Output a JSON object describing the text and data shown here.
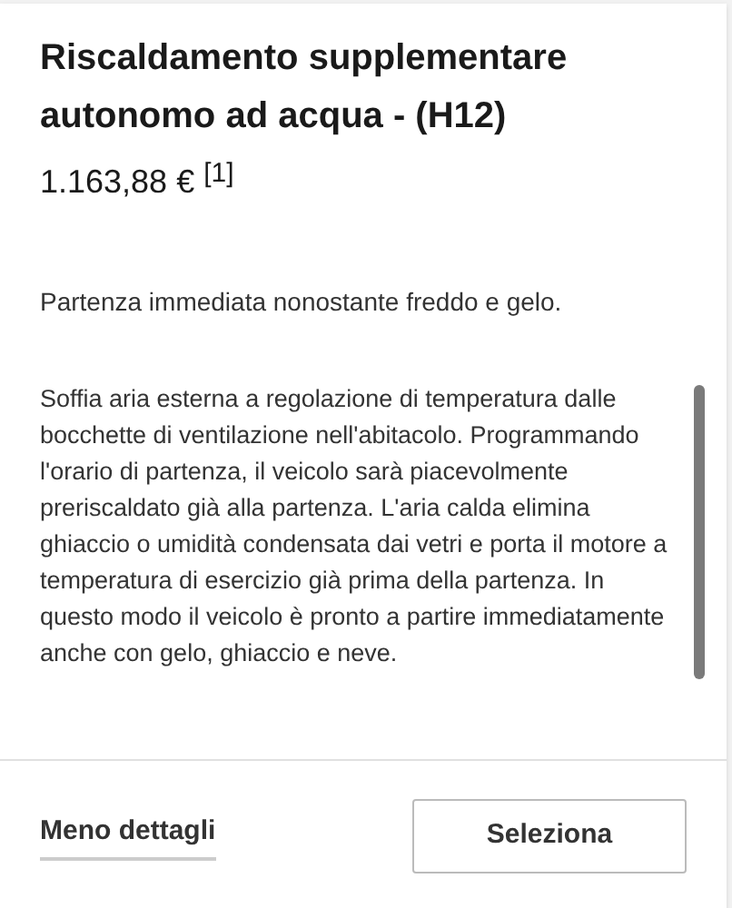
{
  "title": "Riscaldamento supplementare autonomo ad acqua - (H12)",
  "price": "1.163,88 €",
  "footnote": "[1]",
  "tagline": "Partenza immediata nonostante freddo e gelo.",
  "description": "Soffia aria esterna a regolazione di temperatura dalle bocchette di ventilazione nell'abitacolo. Programmando l'orario di partenza, il veicolo sarà piacevolmente preriscaldato già alla partenza. L'aria calda elimina ghiaccio o umidità condensata dai vetri e porta il motore a temperatura di esercizio già prima della partenza. In questo modo il veicolo è pronto a partire immediatamente anche con gelo, ghiaccio e neve.",
  "buttons": [
    {
      "kind": "link",
      "label": "Meno dettagli"
    },
    {
      "kind": "outline",
      "label": "Seleziona"
    }
  ]
}
